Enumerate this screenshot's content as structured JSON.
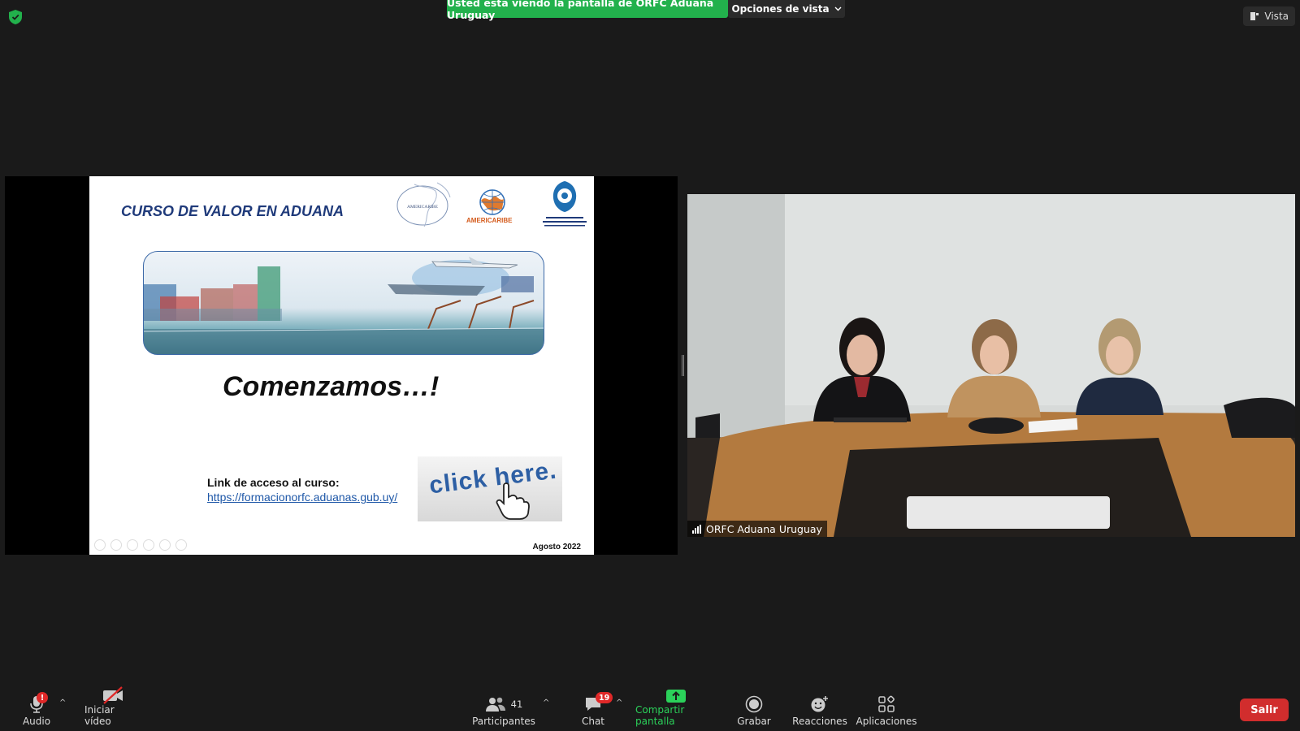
{
  "banner": {
    "sharing_text": "Usted está viendo la pantalla de ORFC Aduana Uruguay",
    "view_options_label": "Opciones de vista",
    "view_label": "Vista"
  },
  "slide": {
    "title": "CURSO DE VALOR EN ADUANA",
    "logo_text": "AMERICARIBE",
    "headline": "Comenzamos…!",
    "link_label": "Link de acceso al curso:",
    "link_url": "https://formacionorfc.aduanas.gub.uy/",
    "click_text": "click here.",
    "date": "Agosto 2022"
  },
  "video": {
    "participant_name": "ORFC Aduana Uruguay"
  },
  "toolbar": {
    "audio_label": "Audio",
    "audio_badge": "!",
    "video_label": "Iniciar vídeo",
    "participants_label": "Participantes",
    "participants_count": "41",
    "chat_label": "Chat",
    "chat_badge": "19",
    "share_label": "Compartir pantalla",
    "record_label": "Grabar",
    "reactions_label": "Reacciones",
    "apps_label": "Aplicaciones",
    "leave_label": "Salir"
  },
  "icons": [
    "shield-icon",
    "chevron-down-icon",
    "view-icon",
    "microphone-icon",
    "video-off-icon",
    "participants-icon",
    "chat-icon",
    "share-screen-icon",
    "record-icon",
    "reactions-icon",
    "apps-icon",
    "signal-icon"
  ],
  "colors": {
    "share_green": "#22b14c",
    "leave_red": "#d12d2d",
    "background": "#1a1a1a"
  }
}
